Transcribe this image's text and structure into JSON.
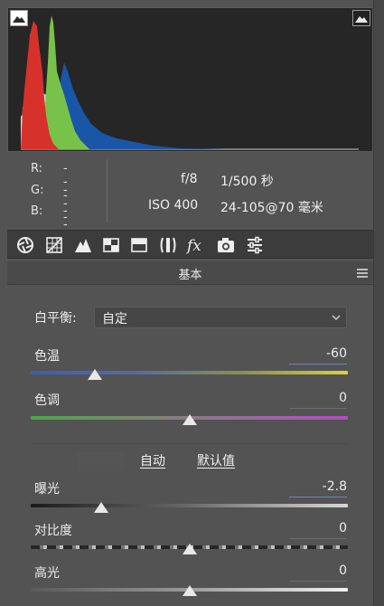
{
  "info": {
    "r_label": "R:",
    "r_value": "---",
    "g_label": "G:",
    "g_value": "---",
    "b_label": "B:",
    "b_value": "---",
    "aperture": "f/8",
    "shutter": "1/500 秒",
    "iso": "ISO 400",
    "lens": "24-105@70 毫米"
  },
  "tools": [
    {
      "name": "basic-aperture-icon"
    },
    {
      "name": "tone-curve-icon"
    },
    {
      "name": "detail-icon"
    },
    {
      "name": "hsl-icon"
    },
    {
      "name": "split-tone-icon"
    },
    {
      "name": "lens-correction-icon"
    },
    {
      "name": "fx-icon"
    },
    {
      "name": "camera-calibration-icon"
    },
    {
      "name": "presets-sliders-icon"
    }
  ],
  "section": {
    "title": "基本"
  },
  "white_balance": {
    "label": "白平衡:",
    "value": "自定"
  },
  "sliders": {
    "temp": {
      "label": "色温",
      "value": "-60"
    },
    "tint": {
      "label": "色调",
      "value": "0"
    },
    "exposure": {
      "label": "曝光",
      "value": "-2.8"
    },
    "contrast": {
      "label": "对比度",
      "value": "0"
    },
    "highlights": {
      "label": "高光",
      "value": "0"
    }
  },
  "actions": {
    "auto": "自动",
    "default": "默认值"
  },
  "colors": {
    "panel": "#535353",
    "histogram_bg": "#262626",
    "toolbar": "#3c3c3c"
  }
}
